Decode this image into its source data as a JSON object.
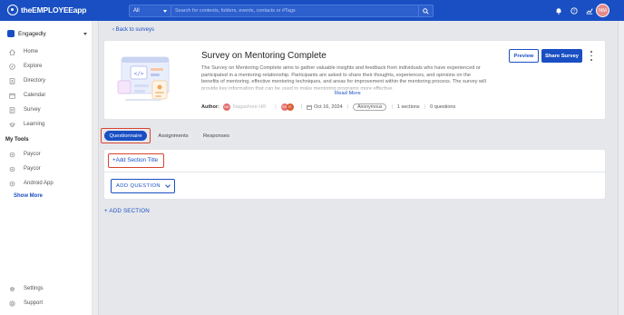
{
  "app": {
    "logo_text": "theEMPLOYEEapp"
  },
  "search": {
    "filter": "All",
    "placeholder": "Search for contents, folders, events, contacts or #Tags"
  },
  "user": {
    "initials": "NM"
  },
  "sidebar": {
    "org_name": "Engagedly",
    "items": [
      {
        "label": "Home",
        "icon": "home-icon"
      },
      {
        "label": "Explore",
        "icon": "compass-icon"
      },
      {
        "label": "Directory",
        "icon": "directory-icon"
      },
      {
        "label": "Calendar",
        "icon": "calendar-icon"
      },
      {
        "label": "Survey",
        "icon": "survey-icon"
      },
      {
        "label": "Learning",
        "icon": "learning-icon"
      }
    ],
    "tools_heading": "My Tools",
    "tools": [
      {
        "label": "Paycor",
        "icon": "tool-icon"
      },
      {
        "label": "Paycor",
        "icon": "tool-icon"
      },
      {
        "label": "Android App",
        "icon": "tool-icon"
      }
    ],
    "show_more": "Show More",
    "bottom": [
      {
        "label": "Settings",
        "icon": "gear-icon"
      },
      {
        "label": "Support",
        "icon": "support-icon"
      }
    ]
  },
  "survey": {
    "back_link": "Back to surveys",
    "title": "Survey on Mentoring Complete",
    "description": "The Survey on Mentoring Complete aims to gather valuable insights and feedback from individuals who have experienced or participated in a mentoring relationship. Participants are asked to share their thoughts, experiences, and opinions on the benefits of mentoring, effective mentoring techniques, and areas for improvement within the mentoring process. The survey will provide key information that can be used to make mentoring programs more effective.",
    "read_more": "Read More",
    "author_label": "Author:",
    "author_initials": "NM",
    "author_name": "Nagashree HR",
    "collaborators": [
      "RR",
      "R"
    ],
    "date": "Oct 16, 2024",
    "anonymity": "Anonymous",
    "sections": "1 sections",
    "questions": "0 questions",
    "preview_label": "Preview",
    "share_label": "Share Survey"
  },
  "tabs": [
    {
      "label": "Questionnaire",
      "active": true
    },
    {
      "label": "Assignments",
      "active": false
    },
    {
      "label": "Responses",
      "active": false
    }
  ],
  "editor": {
    "add_section_title": "+Add Section Title",
    "add_question": "ADD QUESTION",
    "add_section": "+ ADD SECTION"
  },
  "colors": {
    "brand": "#1a4fc3",
    "highlight": "#d9442e"
  }
}
